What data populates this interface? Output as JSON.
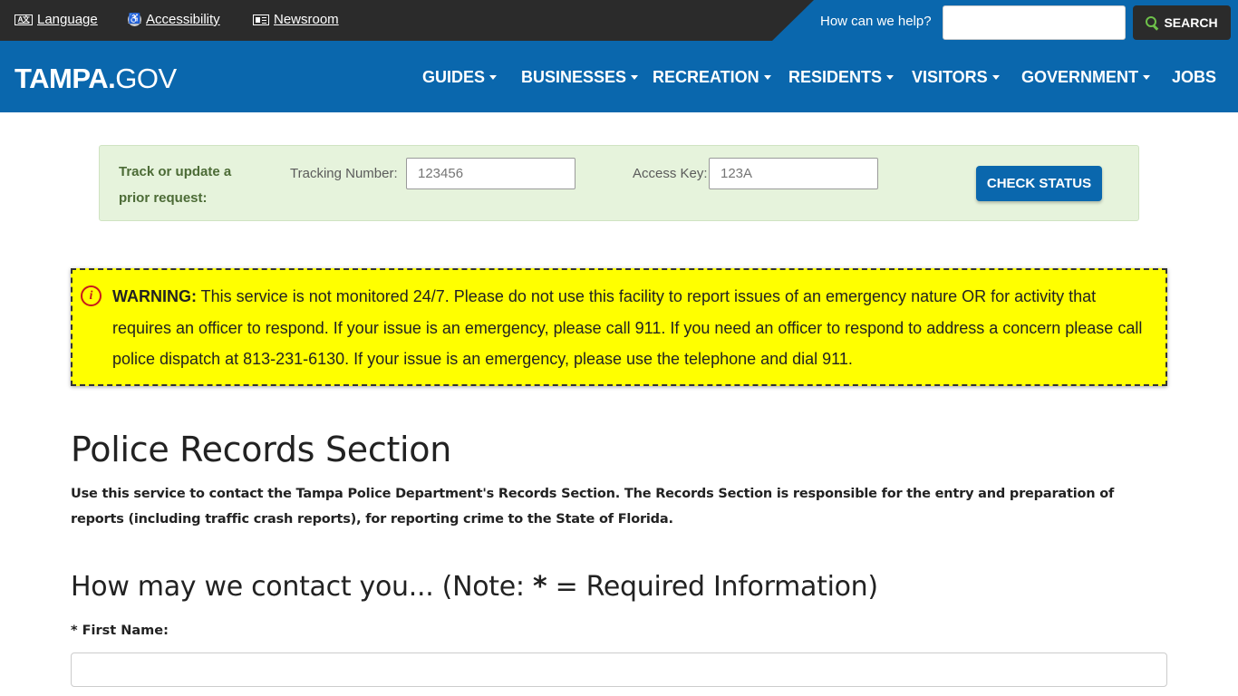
{
  "utility": {
    "language": "Language",
    "accessibility": "Accessibility",
    "newsroom": "Newsroom",
    "help_label": "How can we help?",
    "search_value": "",
    "search_button": "SEARCH"
  },
  "header": {
    "logo_bold": "TAMPA.",
    "logo_thin": "GOV",
    "nav": [
      "GUIDES",
      "BUSINESSES",
      "RECREATION",
      "RESIDENTS",
      "VISITORS",
      "GOVERNMENT",
      "JOBS"
    ]
  },
  "tracking": {
    "title": "Track or update a prior request:",
    "tracking_label": "Tracking Number:",
    "tracking_placeholder": "123456",
    "access_label": "Access Key:",
    "access_placeholder": "123A",
    "button": "CHECK STATUS"
  },
  "warning": {
    "label": "WARNING:",
    "text": " This service is not monitored 24/7. Please do not use this facility to report issues of an emergency nature OR for activity that requires an officer to respond. If your issue is an emergency, please call 911. If you need an officer to respond to address a concern please call police dispatch at 813-231-6130. If your issue is an emergency, please use the telephone and dial 911."
  },
  "main": {
    "title": "Police Records Section",
    "intro": "Use this service to contact the Tampa Police Department's Records Section. The Records Section is responsible for the entry and preparation of reports (including traffic crash reports), for reporting crime to the State of Florida.",
    "section_heading_pre": "How may we contact you...  (Note: ",
    "section_heading_star": "*",
    "section_heading_post": " = Required Information)",
    "first_name_label": "* First Name:",
    "first_name_value": ""
  },
  "colors": {
    "brand_blue": "#0a67ad",
    "utility_dark": "#2b2b2b",
    "warning_yellow": "#ffff00",
    "panel_green": "#e6f3dc",
    "search_icon_green": "#6ec14a"
  }
}
